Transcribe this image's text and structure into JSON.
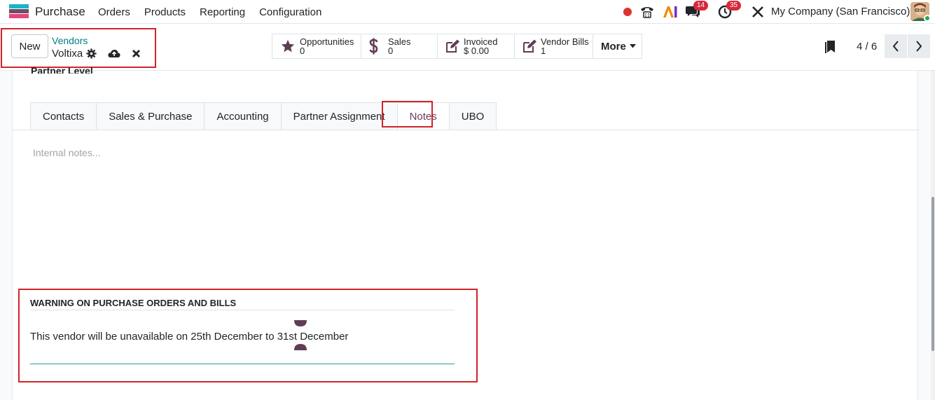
{
  "app": {
    "name": "Purchase"
  },
  "menu": [
    "Orders",
    "Products",
    "Reporting",
    "Configuration"
  ],
  "systray": {
    "messages_count": "14",
    "activities_count": "35",
    "company": "My Company (San Francisco)"
  },
  "control": {
    "new_label": "New",
    "breadcrumb_parent": "Vendors",
    "breadcrumb_current": "Voltixa",
    "smart_buttons": [
      {
        "label": "Opportunities",
        "value": "0",
        "icon": "star-icon"
      },
      {
        "label": "Sales",
        "value": "0",
        "icon": "dollar-icon"
      },
      {
        "label": "Invoiced",
        "value": "$ 0.00",
        "icon": "edit-icon"
      },
      {
        "label": "Vendor Bills",
        "value": "1",
        "icon": "edit-icon"
      }
    ],
    "more_label": "More",
    "pager": "4 / 6"
  },
  "form": {
    "partner_level": "Partner Level",
    "tabs": [
      "Contacts",
      "Sales & Purchase",
      "Accounting",
      "Partner Assignment",
      "Notes",
      "UBO"
    ],
    "active_tab": "Notes",
    "notes_placeholder": "Internal notes...",
    "warning_title": "WARNING ON PURCHASE ORDERS AND BILLS",
    "warning_text": "This vendor will be unavailable on 25th December to 31st December"
  },
  "colors": {
    "accent": "#017e84",
    "brand": "#714b67",
    "highlight": "#d1232a"
  }
}
